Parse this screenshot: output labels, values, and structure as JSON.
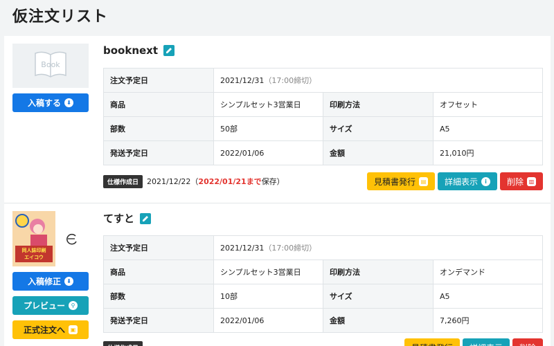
{
  "page": {
    "title": "仮注文リスト"
  },
  "colors": {
    "blue": "#1478e6",
    "teal": "#17a2b8",
    "yellow": "#ffc107",
    "red": "#e3342f",
    "dark": "#333333"
  },
  "labels": {
    "order_date": "注文予定日",
    "product": "商品",
    "print_method": "印刷方法",
    "copies": "部数",
    "size": "サイズ",
    "ship_date": "発送予定日",
    "amount": "金額",
    "spec_badge": "仕様作成日",
    "estimate": "見積書発行",
    "details": "詳細表示",
    "delete": "削除"
  },
  "orders": [
    {
      "name": "booknext",
      "thumb_text": "Book",
      "side_buttons": [
        "入稿する"
      ],
      "order_date": "2021/12/31",
      "deadline": "（17:00締切）",
      "product": "シンプルセット3営業日",
      "print_method": "オフセット",
      "copies": "50部",
      "size": "A5",
      "ship_date": "2022/01/06",
      "amount": "21,010円",
      "created": "2021/12/22",
      "save_open": "（",
      "save_until": "2022/01/21まで",
      "save_close": "保存）"
    },
    {
      "name": "てすと",
      "cover_title": "同人誌印刷",
      "cover_subtitle": "エイコウ",
      "side_buttons": [
        "入稿修正",
        "プレビュー",
        "正式注文へ"
      ],
      "order_date": "2021/12/31",
      "deadline": "（17:00締切）",
      "product": "シンプルセット3営業日",
      "print_method": "オンデマンド",
      "copies": "10部",
      "size": "A5",
      "ship_date": "2022/01/06",
      "amount": "7,260円"
    }
  ]
}
